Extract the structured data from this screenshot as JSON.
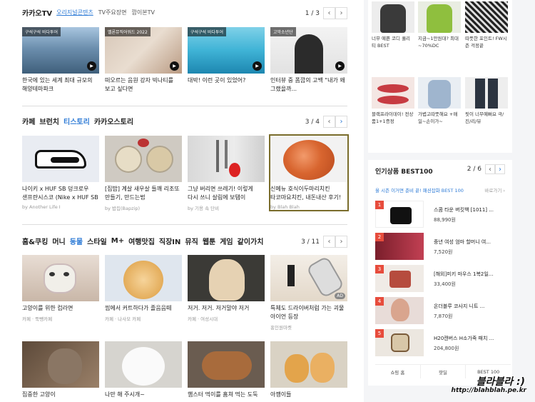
{
  "kakaotv": {
    "tabs": [
      "카카오TV",
      "오리지널콘텐츠",
      "TV주요장면",
      "깜이본TV"
    ],
    "page": "1 / 3",
    "cards": [
      {
        "badge": "구석구석 바다투어",
        "title": "한국에 있는 세계 최대 규모의 해양테마파크"
      },
      {
        "badge": "멜론뮤직어워드 2022",
        "title": "떠오르는 음원 강자 빅나티를 보고 싶다면"
      },
      {
        "badge": "구석구석 바다투어",
        "title": "대박! 이런 곳이 있었어?"
      },
      {
        "badge": "고막소년단",
        "title": "인터뷰 중 폼깝의 고백 \"내가 왜 그랬을까..."
      }
    ]
  },
  "cafe": {
    "tabs": [
      "카페",
      "브런치",
      "티스토리",
      "카카오스토리"
    ],
    "page": "3 / 4",
    "cards": [
      {
        "title": "나이키 x HUF SB 덩크로우 샌프란시스코 (Nike x HUF SB",
        "src": "by Another Life I"
      },
      {
        "title": "[집밥] 계살 새우살 들깨 리조또 만들기, 만드는법",
        "src": "by 밥집(Bapzip)"
      },
      {
        "title": "그냥 버리면 쓰레기! 이렇게 다시 쓰니 살림에 보탬이",
        "src": "by 기용 속 단비"
      },
      {
        "title": "신메뉴 호식이두마리치킨 타코마요치킨, 내돈내산 후기!",
        "src": "by Blah Blah"
      }
    ]
  },
  "hobby": {
    "tabs": [
      "홈&쿠킹",
      "머니",
      "동물",
      "스타일",
      "M+",
      "여행맛집",
      "직장IN",
      "뮤직",
      "웹툰",
      "게임",
      "같이가치"
    ],
    "page": "3 / 11",
    "cards": [
      {
        "title": "고양이를 위한 컵라면",
        "src": "카페 · 뚝뺑카페"
      },
      {
        "title": "씹에서 커트하다가 졸음음떼",
        "src": "카페 · 나사모 카페"
      },
      {
        "title": "저거. 저거. 저거말야 저거",
        "src": "카페 · 여성시대"
      },
      {
        "title": "특체도 드라이버처럼 가는 괴물 아이언 등장",
        "src": "홍인원마켓",
        "ad": "AD"
      },
      {
        "title": "집중한 고양이",
        "src": ""
      },
      {
        "title": "나만 해 주시개~",
        "src": ""
      },
      {
        "title": "햄스터 먹이를 훔쳐 먹는 도둑",
        "src": ""
      },
      {
        "title": "아깽이들",
        "src": ""
      }
    ]
  },
  "fashion": [
    {
      "text": "너무 예쁜 코디 퀄리티 BEST"
    },
    {
      "text": "지금~1만원대? 최대~70%DC"
    },
    {
      "text": "따뜻한 포인트! FW시즌 걱정끝"
    },
    {
      "text": "블랙프라이데이! 전상품1+1증정"
    },
    {
      "text": "가볍고따뜻해요 +매일~손이가~"
    },
    {
      "text": "핏이 너무예뻐요 극/진/리/뷰"
    }
  ],
  "popular": {
    "title": "인기상품 BEST100",
    "page": "2 / 6",
    "sub": "올 시즌 이거면 준비 끝! 패션잡화 BEST 100",
    "more": "바로가기 ›",
    "items": [
      {
        "rank": "1",
        "name": "스콤 타운 버킷백 [1011] ...",
        "price": "88,990원"
      },
      {
        "rank": "2",
        "name": "중년 여성 엄마 할머니 여...",
        "price": "7,520원"
      },
      {
        "rank": "3",
        "name": "[해외]미키 마우스 1복2일...",
        "price": "33,400원"
      },
      {
        "rank": "4",
        "name": "온더블루 코사지 니트 ...",
        "price": "7,870원"
      },
      {
        "rank": "5",
        "name": "H20캔버스 H소가죽 패치 ...",
        "price": "204,800원"
      }
    ],
    "tabs": [
      "쇼핑 홈",
      "핫딜",
      "BEST 100"
    ]
  },
  "watermark": {
    "line1": "블라블라 :)",
    "line2": "http://blahblah.pe.kr"
  },
  "colors": {
    "accent": "#2e7bd6",
    "rank": "#e74c3c",
    "selected_border": "#7a6d2c"
  }
}
